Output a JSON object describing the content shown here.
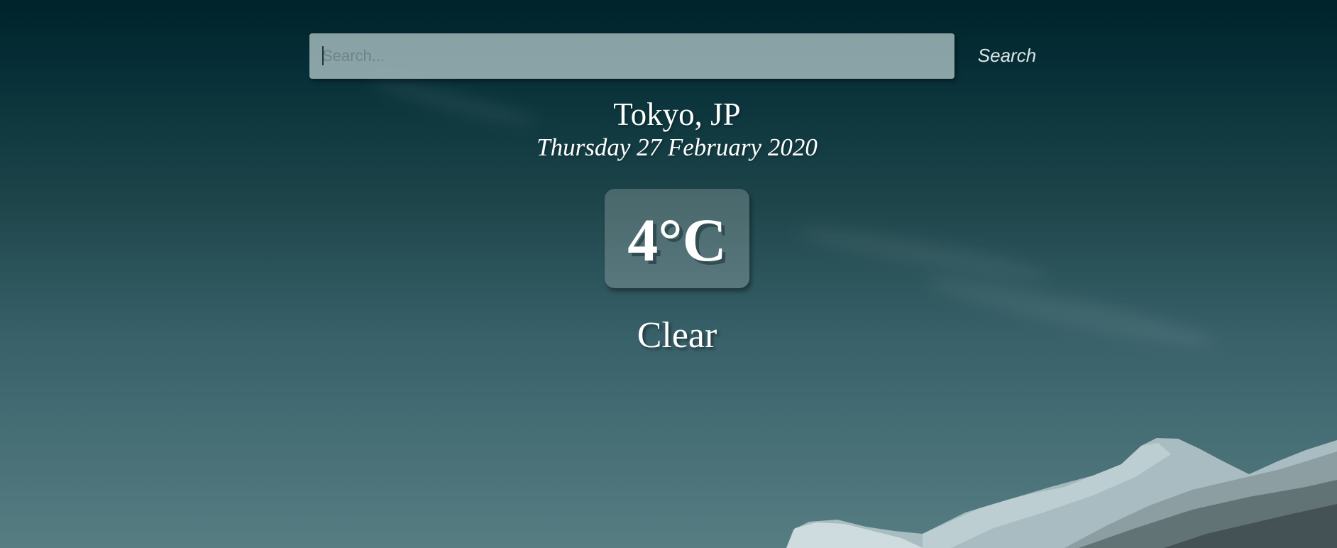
{
  "search": {
    "placeholder": "Search...",
    "value": "",
    "button_label": "Search"
  },
  "weather": {
    "location": "Tokyo, JP",
    "date": "Thursday 27 February 2020",
    "temperature": "4°C",
    "condition": "Clear"
  },
  "colors": {
    "background_top": "#00232a",
    "background_bottom": "#567d82",
    "text": "#ffffff",
    "search_field": "#9fb0b1"
  }
}
